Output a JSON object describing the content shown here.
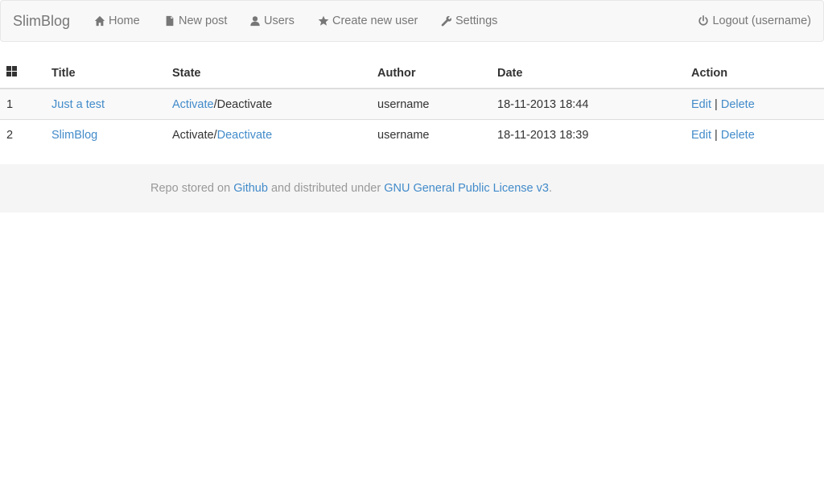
{
  "navbar": {
    "brand": "SlimBlog",
    "items": [
      {
        "label": "Home",
        "icon": "home-icon"
      },
      {
        "label": "New post",
        "icon": "file-icon"
      },
      {
        "label": "Users",
        "icon": "user-icon"
      },
      {
        "label": "Create new user",
        "icon": "star-icon"
      },
      {
        "label": "Settings",
        "icon": "wrench-icon"
      }
    ],
    "logout": {
      "label": "Logout (username)",
      "icon": "power-icon"
    }
  },
  "table": {
    "header_icon": "grid-icon",
    "columns": [
      "Title",
      "State",
      "Author",
      "Date",
      "Action"
    ],
    "rows": [
      {
        "id": "1",
        "title": "Just a test",
        "activate": "Activate",
        "separator": "/",
        "deactivate": "Deactivate",
        "active_link": "activate",
        "author": "username",
        "date": "18-11-2013 18:44",
        "edit": "Edit",
        "action_sep": "|",
        "delete": "Delete"
      },
      {
        "id": "2",
        "title": "SlimBlog",
        "activate": "Activate",
        "separator": "/",
        "deactivate": "Deactivate",
        "active_link": "deactivate",
        "author": "username",
        "date": "18-11-2013 18:39",
        "edit": "Edit",
        "action_sep": "|",
        "delete": "Delete"
      }
    ]
  },
  "footer": {
    "prefix": "Repo stored on ",
    "github_link": "Github",
    "middle": " and distributed under ",
    "license_link": "GNU General Public License v3",
    "suffix": "."
  },
  "colors": {
    "link": "#428bca",
    "navbar_bg": "#f8f8f8",
    "nav_text": "#777777",
    "footer_bg": "#f5f5f5",
    "footer_text": "#999999"
  }
}
